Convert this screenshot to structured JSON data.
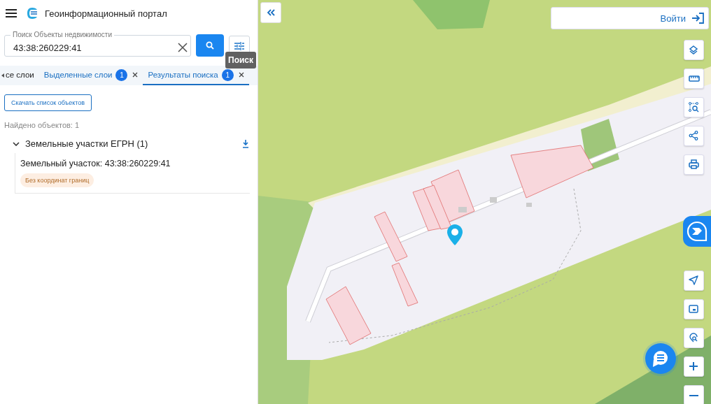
{
  "header": {
    "title": "Геоинформационный портал"
  },
  "search": {
    "label": "Поиск Объекты недвижимости",
    "value": "43:38:260229:41"
  },
  "tooltip": "Поиск",
  "tabs": [
    {
      "label": "се слои",
      "selected": false
    },
    {
      "label": "Выделенные слои",
      "count": "1",
      "selected": false
    },
    {
      "label": "Результаты поиска",
      "count": "1",
      "selected": true
    }
  ],
  "download_button": "Скачать список объектов",
  "found": "Найдено объектов: 1",
  "groups": [
    {
      "title": "Земельные участки ЕГРН (1)",
      "expanded": true,
      "items": [
        {
          "title": "Земельный участок: 43:38:260229:41",
          "tag": "Без координат границ"
        }
      ]
    }
  ],
  "login_button": "Войти"
}
